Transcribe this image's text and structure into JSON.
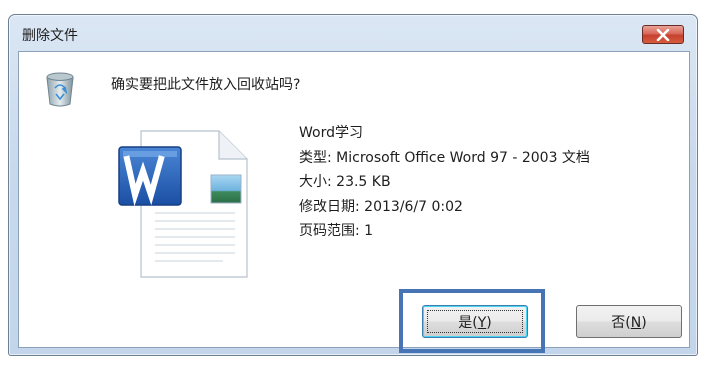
{
  "dialog": {
    "title": "删除文件",
    "close_glyph": "✕",
    "question": "确实要把此文件放入回收站吗?",
    "file": {
      "name": "Word学习",
      "type_line": "类型: Microsoft Office Word 97 - 2003 文档",
      "size_line": "大小: 23.5 KB",
      "modified_line": "修改日期: 2013/6/7 0:02",
      "pages_line": "页码范围: 1"
    },
    "buttons": {
      "yes_label": "是(",
      "yes_accel": "Y",
      "yes_close": ")",
      "no_label": "否(",
      "no_accel": "N",
      "no_close": ")"
    }
  },
  "icons": {
    "recycle": "recycle-bin-icon",
    "document": "word-document-icon",
    "close": "close-icon"
  },
  "colors": {
    "title_gradient_top": "#dbe7f4",
    "close_red": "#c7402f",
    "highlight_blue": "#4674b5",
    "word_blue": "#2a62b8"
  }
}
